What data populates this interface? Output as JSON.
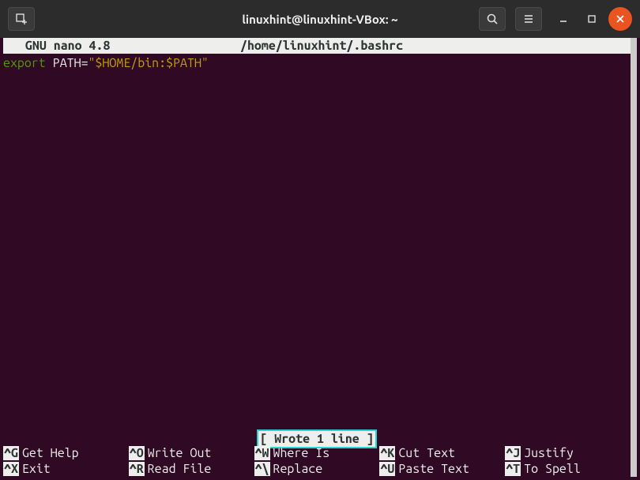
{
  "titlebar": {
    "title": "linuxhint@linuxhint-VBox: ~"
  },
  "nano": {
    "app": "  GNU nano 4.8",
    "file": "/home/linuxhint/.bashrc",
    "status_msg": "[ Wrote 1 line ]"
  },
  "content": {
    "keyword": "export",
    "space": " ",
    "varname": "PATH=",
    "value": "\"$HOME/bin:$PATH\""
  },
  "shortcuts": {
    "cols": [
      {
        "r1k": "^G",
        "r1d": "Get Help",
        "r2k": "^X",
        "r2d": "Exit"
      },
      {
        "r1k": "^O",
        "r1d": "Write Out",
        "r2k": "^R",
        "r2d": "Read File"
      },
      {
        "r1k": "^W",
        "r1d": "Where Is",
        "r2k": "^\\",
        "r2d": "Replace"
      },
      {
        "r1k": "^K",
        "r1d": "Cut Text",
        "r2k": "^U",
        "r2d": "Paste Text"
      },
      {
        "r1k": "^J",
        "r1d": "Justify",
        "r2k": "^T",
        "r2d": "To Spell"
      }
    ]
  }
}
